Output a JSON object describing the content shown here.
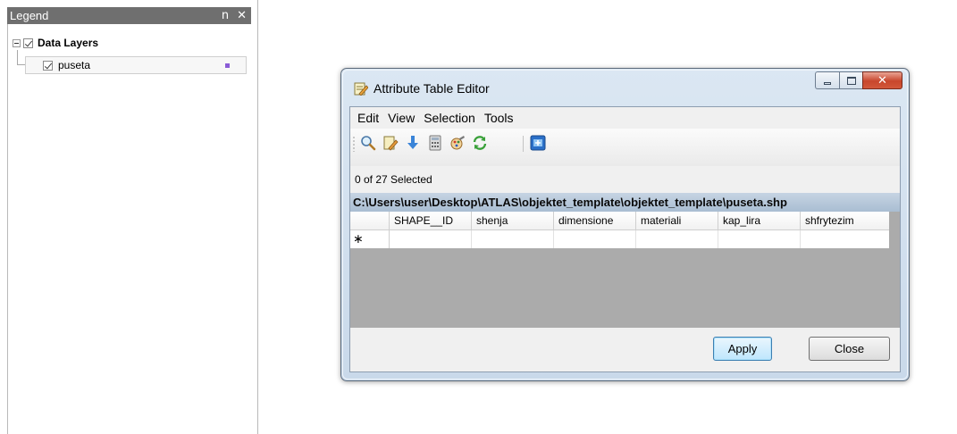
{
  "legend": {
    "title": "Legend",
    "pin_glyph": "ո",
    "close_glyph": "✕",
    "group": {
      "label": "Data Layers",
      "checked": true,
      "expanded": true
    },
    "layers": [
      {
        "label": "puseta",
        "checked": true,
        "symbol_color": "#8a5cd6"
      }
    ]
  },
  "dialog": {
    "title": "Attribute Table Editor",
    "close_glyph": "✕",
    "menu": [
      "Edit",
      "View",
      "Selection",
      "Tools"
    ],
    "toolbar": [
      {
        "name": "zoom-to-selection-icon"
      },
      {
        "name": "edit-icon"
      },
      {
        "name": "import-icon"
      },
      {
        "name": "calculator-icon"
      },
      {
        "name": "field-properties-icon"
      },
      {
        "name": "refresh-icon"
      },
      {
        "name": "export-icon"
      }
    ],
    "selected_count": "0 of 27 Selected",
    "file_path": "C:\\Users\\user\\Desktop\\ATLAS\\objektet_template\\objektet_template\\puseta.shp",
    "columns": [
      "SHAPE__ID",
      "shenja",
      "dimensione",
      "materiali",
      "kap_lira",
      "shfrytezim"
    ],
    "new_row_marker": "∗",
    "buttons": {
      "apply": "Apply",
      "close": "Close"
    }
  },
  "colors": {
    "legend_header": "#6f6f6f",
    "path_bar": "#b3c5d8",
    "close_button": "#c8462c",
    "grid_background": "#ababab"
  }
}
